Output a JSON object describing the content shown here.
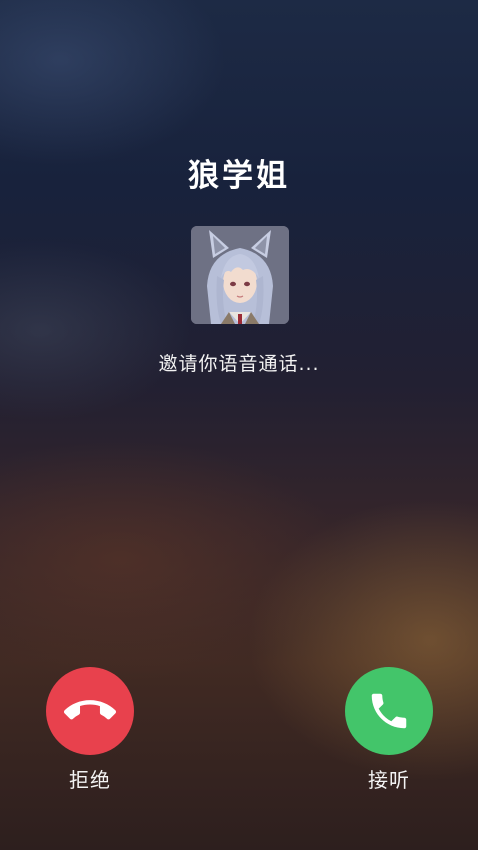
{
  "call": {
    "caller_name": "狼学姐",
    "status": "邀请你语音通话..."
  },
  "actions": {
    "decline_label": "拒绝",
    "accept_label": "接听"
  },
  "icons": {
    "decline": "phone-hangup-icon",
    "accept": "phone-answer-icon"
  },
  "colors": {
    "decline": "#e8414d",
    "accept": "#43c56a"
  }
}
